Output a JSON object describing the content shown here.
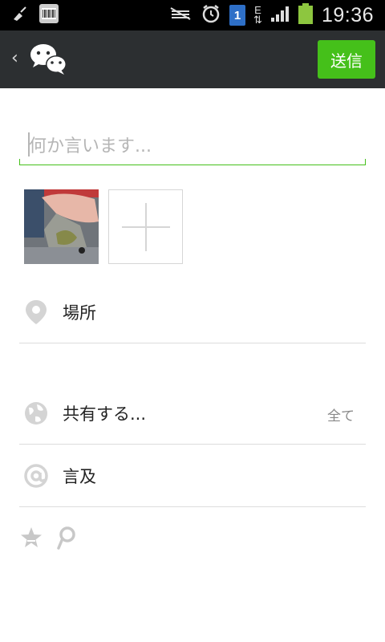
{
  "statusbar": {
    "time": "19:36",
    "sim_slot": "1",
    "network_type": "E",
    "battery_color": "#8dc63f"
  },
  "actionbar": {
    "back_icon": "chevron-left-icon",
    "logo_icon": "wechat-logo-icon",
    "send_label": "送信",
    "send_color": "#45c01a"
  },
  "compose": {
    "placeholder": "何か言います...",
    "value": ""
  },
  "attachments": {
    "photo_icon": "attached-photo",
    "add_icon": "plus-icon"
  },
  "rows": {
    "location": {
      "label": "場所",
      "icon": "location-pin-icon"
    },
    "share": {
      "label": "共有する...",
      "value": "全て",
      "icon": "globe-icon"
    },
    "mention": {
      "label": "言及",
      "icon": "at-sign-icon"
    }
  },
  "footer": {
    "icons": [
      "star-share-icon",
      "p-share-icon"
    ]
  }
}
